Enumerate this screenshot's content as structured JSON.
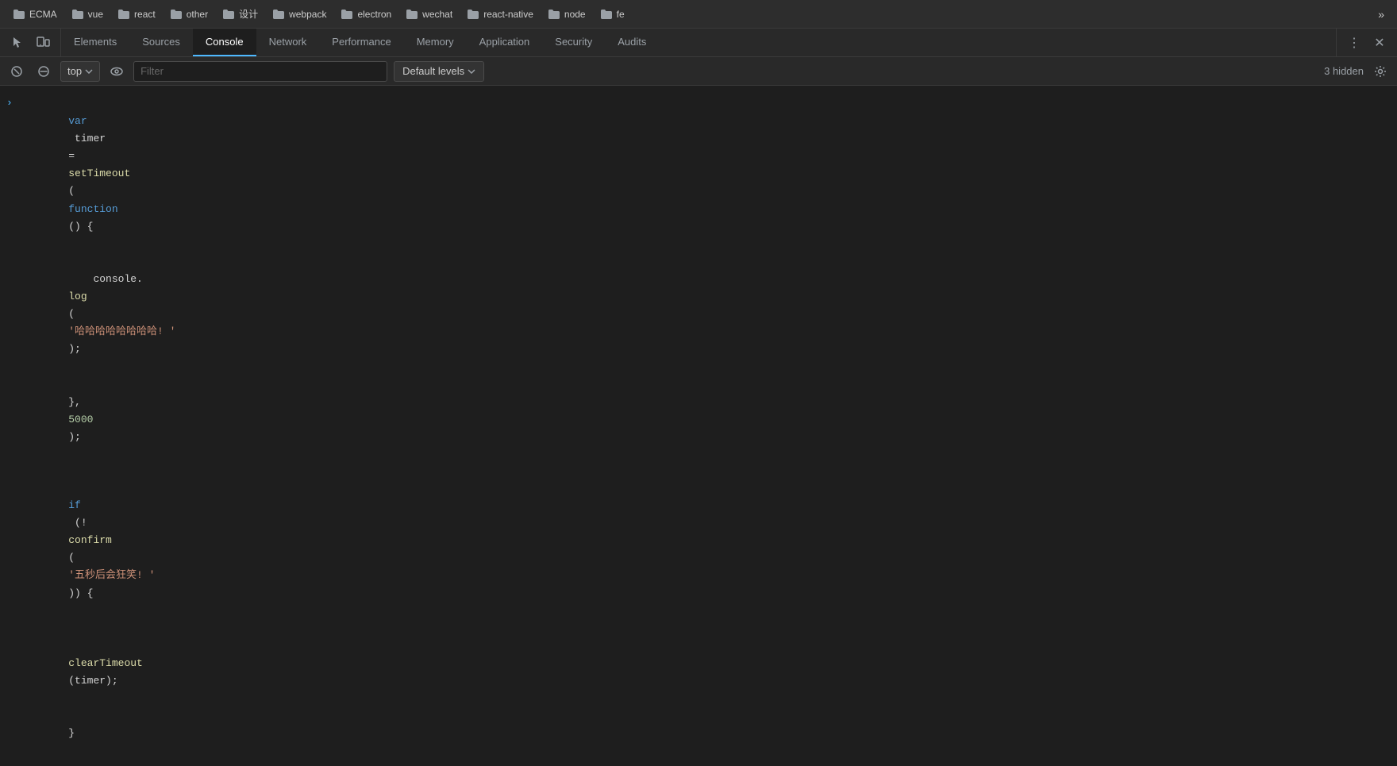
{
  "bookmarks": {
    "items": [
      {
        "label": "ECMA",
        "id": "ecma"
      },
      {
        "label": "vue",
        "id": "vue"
      },
      {
        "label": "react",
        "id": "react"
      },
      {
        "label": "other",
        "id": "other"
      },
      {
        "label": "设计",
        "id": "design"
      },
      {
        "label": "webpack",
        "id": "webpack"
      },
      {
        "label": "electron",
        "id": "electron"
      },
      {
        "label": "wechat",
        "id": "wechat"
      },
      {
        "label": "react-native",
        "id": "react-native"
      },
      {
        "label": "node",
        "id": "node"
      },
      {
        "label": "fe",
        "id": "fe"
      }
    ],
    "more_label": "»"
  },
  "devtools": {
    "tabs": [
      {
        "label": "Elements",
        "id": "elements",
        "active": false
      },
      {
        "label": "Sources",
        "id": "sources",
        "active": false
      },
      {
        "label": "Console",
        "id": "console",
        "active": true
      },
      {
        "label": "Network",
        "id": "network",
        "active": false
      },
      {
        "label": "Performance",
        "id": "performance",
        "active": false
      },
      {
        "label": "Memory",
        "id": "memory",
        "active": false
      },
      {
        "label": "Application",
        "id": "application",
        "active": false
      },
      {
        "label": "Security",
        "id": "security",
        "active": false
      },
      {
        "label": "Audits",
        "id": "audits",
        "active": false
      }
    ],
    "more_icon": "⋮",
    "close_icon": "✕"
  },
  "console_toolbar": {
    "context_label": "top",
    "filter_placeholder": "Filter",
    "levels_label": "Default levels",
    "hidden_count": "3 hidden"
  },
  "console_output": {
    "lines": [
      {
        "type": "code",
        "has_arrow": true,
        "content": "var timer = setTimeout(function() {\n    console.log('哈哈哈哈哈哈哈哈! ');\n}, 5000);"
      },
      {
        "type": "blank"
      },
      {
        "type": "code",
        "has_arrow": false,
        "content": "if (!confirm('五秒后会狂笑! ')) {\n    clearTimeout(timer);\n}"
      }
    ]
  },
  "colors": {
    "active_tab_border": "#4db8ff",
    "keyword": "#569cd6",
    "function": "#dcdcaa",
    "string": "#ce9178",
    "number": "#b5cea8",
    "plain": "#d4d4d4",
    "arrow": "#4db8ff"
  }
}
